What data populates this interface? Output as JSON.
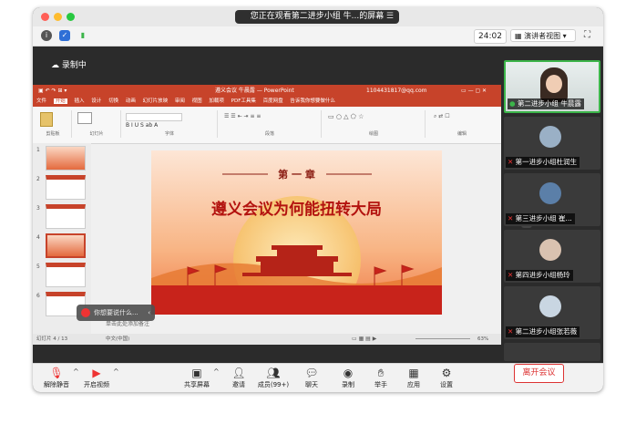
{
  "window": {
    "title": "您正在观看第二进步小组 牛...的屏幕",
    "timer": "24:02",
    "view_label": "演讲者视图"
  },
  "recording": {
    "label": "录制中"
  },
  "ppt": {
    "title_bar": "遵义会议 牛晨露 — PowerPoint",
    "account": "1104431817@qq.com",
    "tabs": [
      "文件",
      "开始",
      "插入",
      "设计",
      "切换",
      "动画",
      "幻灯片放映",
      "审阅",
      "视图",
      "加载项",
      "PDF工具集",
      "百度网盘",
      "告诉我你想要做什么"
    ],
    "ribbon_groups": [
      "剪贴板",
      "幻灯片",
      "字体",
      "段落",
      "绘图",
      "编辑"
    ],
    "slide": {
      "chapter": "第 一 章",
      "title": "遵义会议为何能扭转大局"
    },
    "thumb_numbers": [
      "1",
      "2",
      "3",
      "4",
      "5",
      "6"
    ],
    "notes": "单击此处添加备注",
    "status_left": "幻灯片 4 / 13",
    "status_mid": "中文(中国)",
    "status_zoom": "63%"
  },
  "popup": {
    "text": "你想要说什么..."
  },
  "participants": [
    {
      "name": "第二进步小组 牛晨露",
      "active": true
    },
    {
      "name": "第一进步小组杜润生",
      "active": false
    },
    {
      "name": "第三进步小组 崔...",
      "active": false
    },
    {
      "name": "第四进步小组杨玲",
      "active": false
    },
    {
      "name": "第二进步小组张若薇",
      "active": false
    }
  ],
  "bottom": {
    "unmute": "解除静音",
    "video": "开启视频",
    "share": "共享屏幕",
    "invite": "邀请",
    "members": "成员(99+)",
    "chat": "聊天",
    "record": "录制",
    "raise": "举手",
    "apps": "应用",
    "settings": "设置",
    "leave": "离开会议"
  },
  "colors": {
    "accent_red": "#c7432a",
    "leave_red": "#d33333",
    "active_green": "#3cb54a"
  }
}
